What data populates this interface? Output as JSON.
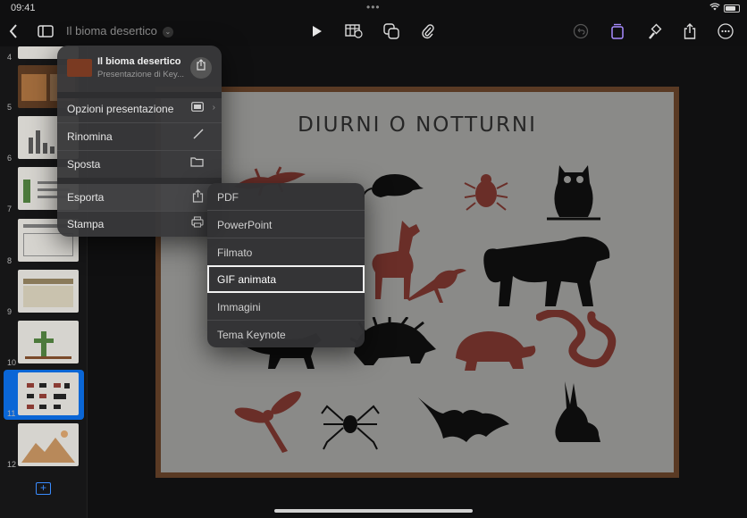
{
  "status": {
    "time": "09:41",
    "dots": "•••"
  },
  "toolbar": {
    "title": "Il bioma desertico",
    "back_icon": "chevron-left-icon",
    "sidebar_icon": "sidebar-icon",
    "play_icon": "play-icon",
    "table_icon": "table-icon",
    "shapes_icon": "shapes-icon",
    "attach_icon": "paperclip-icon",
    "undo_icon": "undo-icon",
    "format_icon": "format-icon",
    "brush_icon": "brush-icon",
    "share_icon": "share-icon",
    "more_icon": "more-icon"
  },
  "navigator": {
    "slides": [
      {
        "num": "4"
      },
      {
        "num": "5"
      },
      {
        "num": "6"
      },
      {
        "num": "7"
      },
      {
        "num": "8"
      },
      {
        "num": "9"
      },
      {
        "num": "10"
      },
      {
        "num": "11"
      },
      {
        "num": "12"
      }
    ]
  },
  "slide": {
    "title": "DIURNI O NOTTURNI"
  },
  "menu": {
    "doc_name": "Il bioma desertico",
    "doc_sub": "Presentazione di Key...",
    "items": {
      "options": "Opzioni presentazione",
      "rename": "Rinomina",
      "move": "Sposta",
      "export": "Esporta",
      "print": "Stampa"
    }
  },
  "submenu": {
    "items": [
      "PDF",
      "PowerPoint",
      "Filmato",
      "GIF animata",
      "Immagini",
      "Tema Keynote"
    ],
    "selected": "GIF animata"
  },
  "colors": {
    "accent": "#0a66d6",
    "slide_bg": "#8a8a88",
    "frame": "#5a3a24",
    "red_animal": "#8a3b33",
    "dark_animal": "#0d0d0d"
  }
}
